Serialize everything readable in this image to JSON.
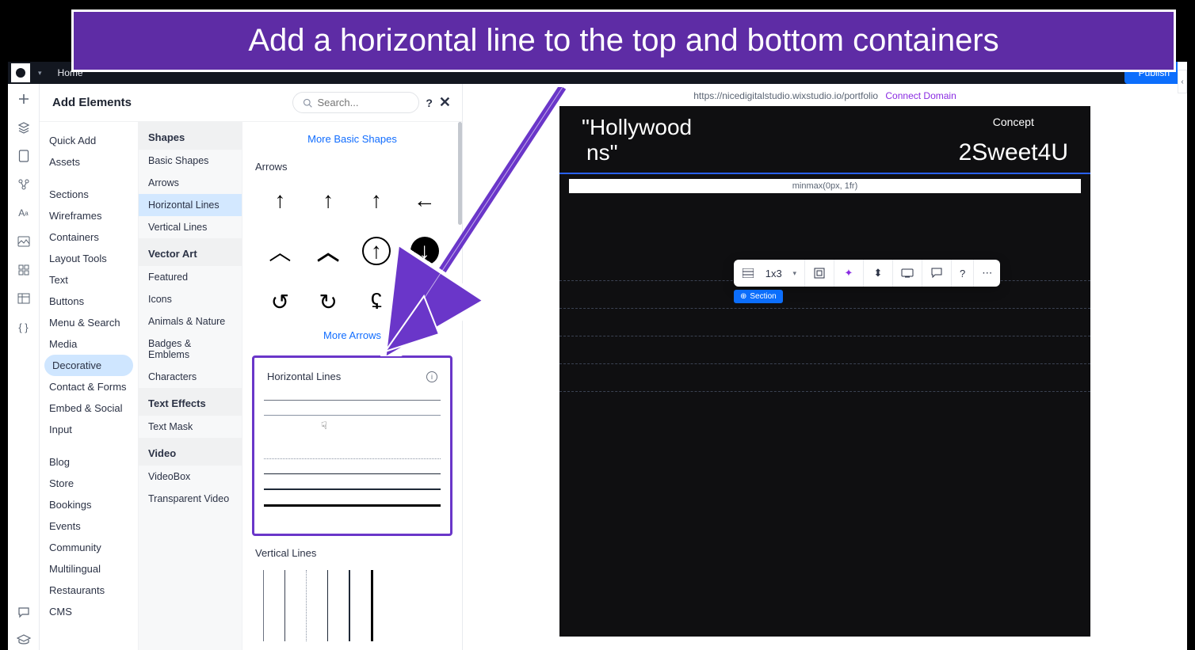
{
  "callout": {
    "text": "Add a horizontal line to the top and bottom containers"
  },
  "topbar": {
    "home": "Home",
    "publish": "Publish"
  },
  "panel": {
    "title": "Add Elements",
    "search_placeholder": "Search...",
    "help": "?",
    "more_basic": "More Basic Shapes",
    "more_arrows": "More Arrows",
    "sections": {
      "arrows": "Arrows",
      "hlines": "Horizontal Lines",
      "vlines": "Vertical Lines"
    }
  },
  "col1": {
    "items_a": [
      "Quick Add",
      "Assets"
    ],
    "items_b": [
      "Sections",
      "Wireframes",
      "Containers",
      "Layout Tools",
      "Text",
      "Buttons",
      "Menu & Search",
      "Media",
      "Decorative",
      "Contact & Forms",
      "Embed & Social",
      "Input"
    ],
    "items_c": [
      "Blog",
      "Store",
      "Bookings",
      "Events",
      "Community",
      "Multilingual",
      "Restaurants",
      "CMS"
    ],
    "active": "Decorative"
  },
  "col2": {
    "groups": [
      {
        "head": "Shapes",
        "items": [
          "Basic Shapes",
          "Arrows",
          "Horizontal Lines",
          "Vertical Lines"
        ],
        "active": "Horizontal Lines"
      },
      {
        "head": "Vector Art",
        "items": [
          "Featured",
          "Icons",
          "Animals & Nature",
          "Badges & Emblems",
          "Characters"
        ]
      },
      {
        "head": "Text Effects",
        "items": [
          "Text Mask"
        ]
      },
      {
        "head": "Video",
        "items": [
          "VideoBox",
          "Transparent Video"
        ]
      }
    ]
  },
  "canvas": {
    "url": "https://nicedigitalstudio.wixstudio.io/portfolio",
    "connect": "Connect Domain",
    "hero_left_1": "\"Hollywood",
    "hero_left_2": "ns\"",
    "concept": "Concept",
    "brand": "2Sweet4U",
    "minmax": "minmax(0px, 1fr)",
    "grid": "1x3",
    "section_tag": "Section"
  },
  "toolbar_icons": {
    "layout": "layout-grid-icon",
    "ai": "sparkle-icon",
    "stack": "stack-icon",
    "device": "device-icon",
    "comment": "comment-icon",
    "help": "?",
    "more": "⋯"
  }
}
